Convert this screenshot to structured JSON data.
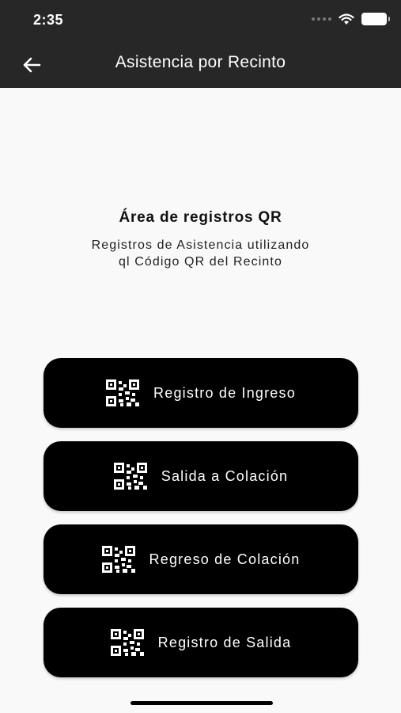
{
  "status_bar": {
    "time": "2:35",
    "icons": [
      "signal-dots-icon",
      "wifi-icon",
      "battery-icon"
    ]
  },
  "header": {
    "back_icon": "arrow-left-icon",
    "title": "Asistencia por Recinto",
    "background": "#272727"
  },
  "intro": {
    "heading": "Área de registros QR",
    "subtitle_line1": "Registros de Asistencia utilizando",
    "subtitle_line2": "ql Código QR del Recinto"
  },
  "buttons": [
    {
      "label": "Registro de Ingreso",
      "icon": "qr-code-icon"
    },
    {
      "label": "Salida a Colación",
      "icon": "qr-code-icon"
    },
    {
      "label": "Regreso de Colación",
      "icon": "qr-code-icon"
    },
    {
      "label": "Registro de Salida",
      "icon": "qr-code-icon"
    }
  ],
  "colors": {
    "page_background": "#f9f9f9",
    "button_background": "#000000",
    "button_text": "#ffffff"
  }
}
